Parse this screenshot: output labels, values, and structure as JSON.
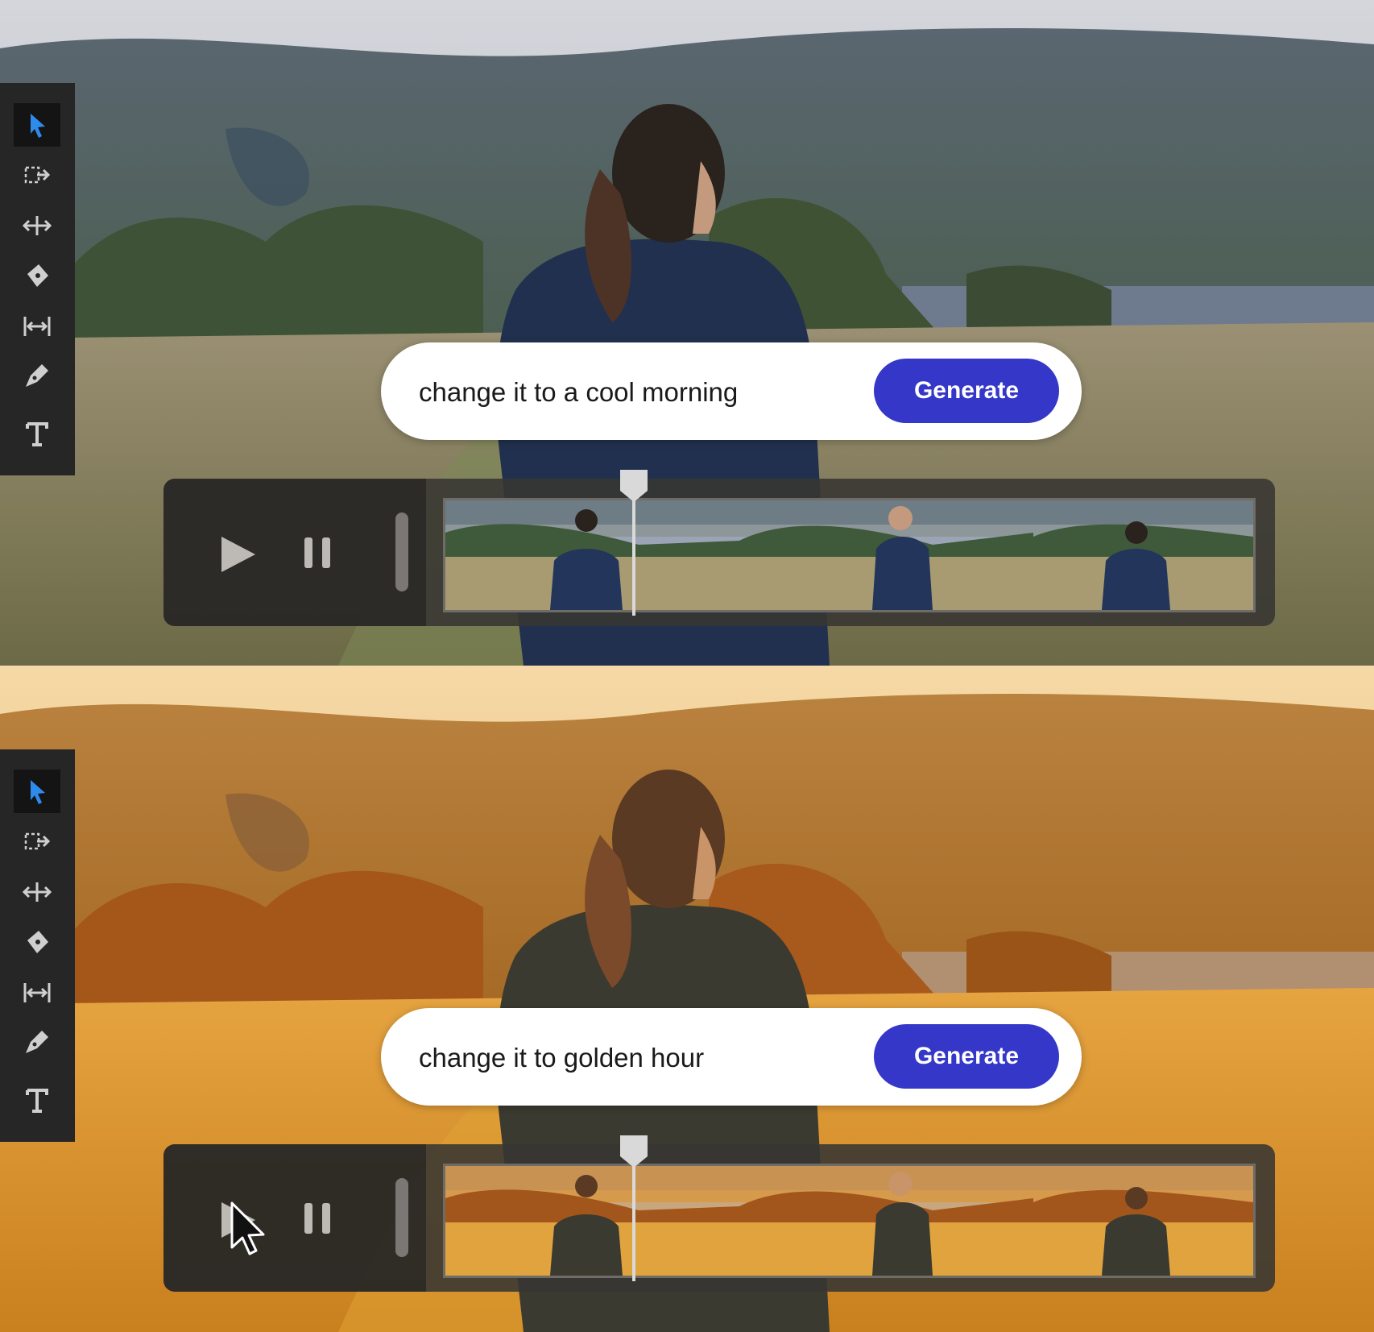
{
  "panels": [
    {
      "theme": "cool",
      "prompt": {
        "text": "change it to a cool morning",
        "button_label": "Generate"
      },
      "timeline": {
        "frames": 3,
        "playhead_fraction": 0.22
      }
    },
    {
      "theme": "golden",
      "prompt": {
        "text": "change it to golden hour",
        "button_label": "Generate"
      },
      "timeline": {
        "frames": 3,
        "playhead_fraction": 0.22
      }
    }
  ],
  "toolbar": {
    "tools": [
      "selection-arrow-icon",
      "track-select-icon",
      "ripple-edit-icon",
      "razor-icon",
      "slip-icon",
      "pen-icon",
      "type-icon"
    ],
    "active": "selection-arrow-icon"
  },
  "colors": {
    "accent": "#3437c8",
    "active_tool": "#2d8ceb",
    "toolbar_bg": "#262626"
  }
}
